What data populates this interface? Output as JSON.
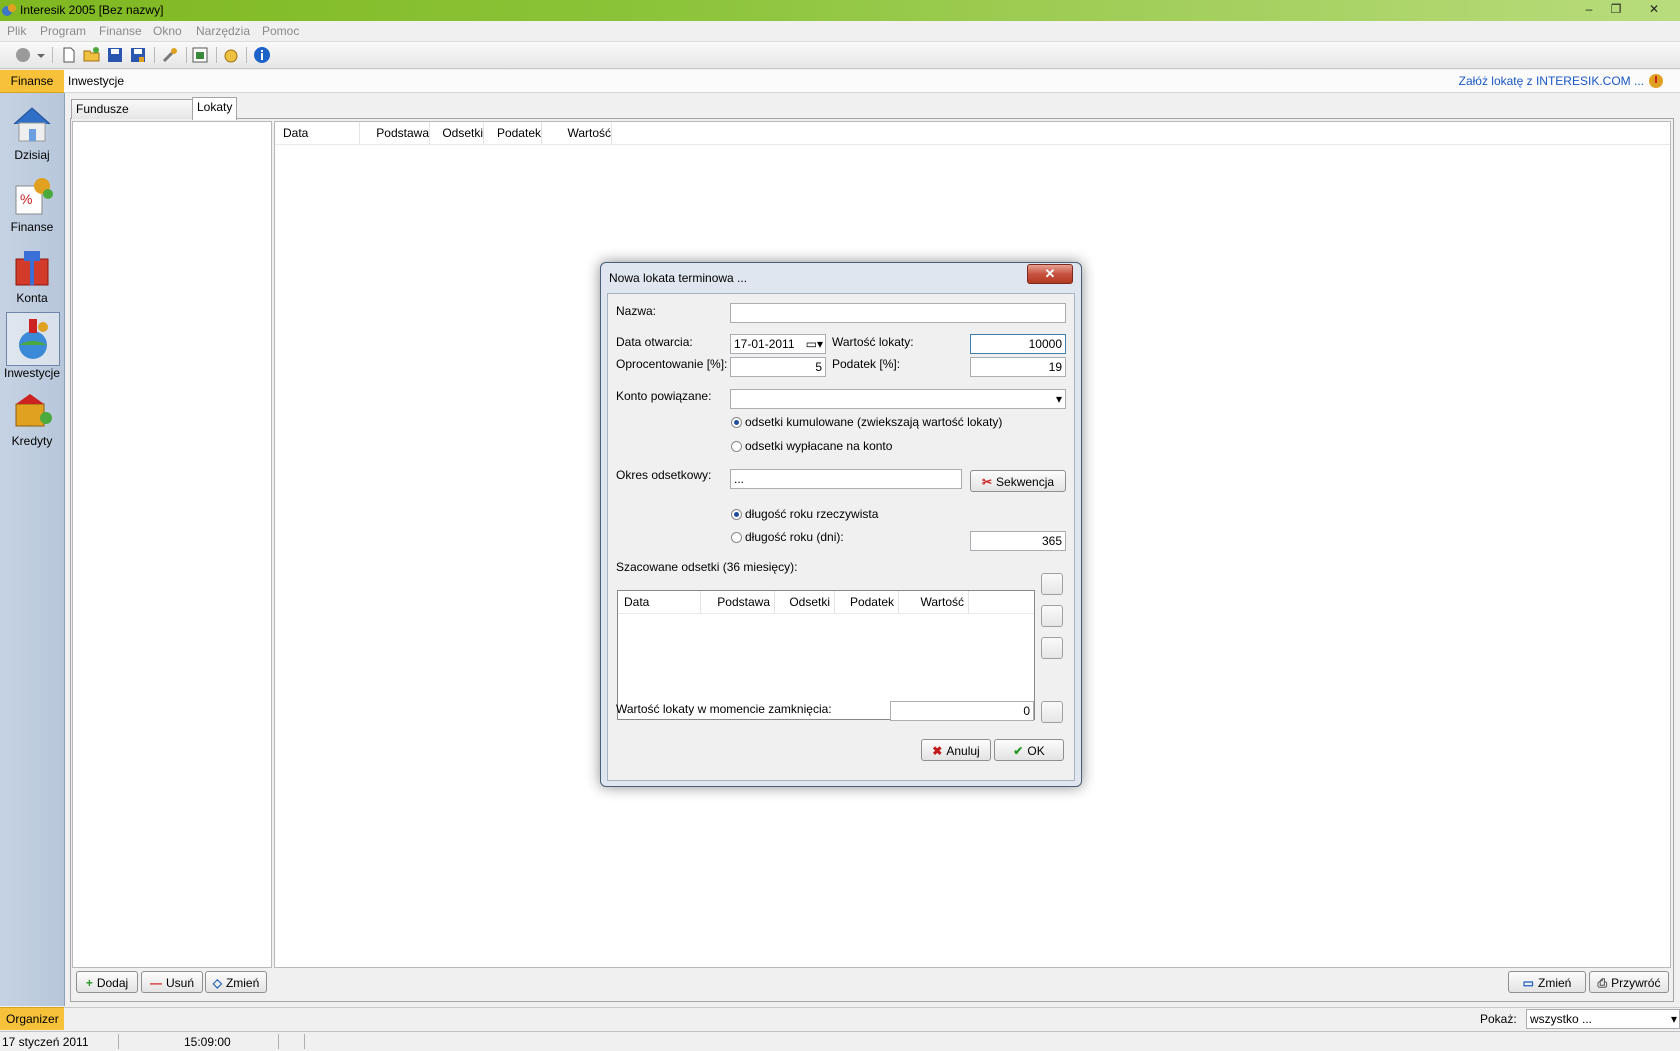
{
  "window": {
    "title": "Interesik 2005 [Bez nazwy]",
    "min": "–",
    "max": "❐",
    "close": "✕"
  },
  "menu": [
    "Plik",
    "Program",
    "Finanse",
    "Okno",
    "Narzędzia",
    "Pomoc"
  ],
  "toolbar_icons": [
    "record-icon",
    "dropdown-arrow-icon",
    "new-file-icon",
    "open-folder-icon",
    "save-icon",
    "save-as-icon",
    "tools-icon",
    "report-icon",
    "hand-icon",
    "info-icon"
  ],
  "left_nav": {
    "header": "Finanse",
    "items": [
      {
        "label": "Dzisiaj",
        "icon": "house-icon"
      },
      {
        "label": "Finanse",
        "icon": "finance-icon"
      },
      {
        "label": "Konta",
        "icon": "accounts-icon"
      },
      {
        "label": "Inwestycje",
        "icon": "investments-icon"
      },
      {
        "label": "Kredyty",
        "icon": "credits-icon"
      }
    ],
    "footer": "Organizer"
  },
  "header": {
    "section": "Inwestycje",
    "promo_link": "Załóż lokatę z INTERESIK.COM ..."
  },
  "tabs": [
    {
      "label": "Fundusze inwestycyjne"
    },
    {
      "label": "Lokaty"
    }
  ],
  "main_table": {
    "columns": [
      "Data",
      "Podstawa",
      "Odsetki",
      "Podatek",
      "Wartość"
    ]
  },
  "bottom_buttons": {
    "add": "Dodaj",
    "remove": "Usuń",
    "change": "Zmień",
    "change_right": "Zmień",
    "restore": "Przywróć"
  },
  "filter": {
    "label": "Pokaż:",
    "value": "wszystko ..."
  },
  "status": {
    "date": "17 styczeń 2011",
    "time": "15:09:00"
  },
  "dialog": {
    "title": "Nowa lokata terminowa ...",
    "name_label": "Nazwa:",
    "name_value": "",
    "open_date_label": "Data otwarcia:",
    "open_date_value": "17-01-2011",
    "deposit_value_label": "Wartość lokaty:",
    "deposit_value": "10000",
    "interest_label": "Oprocentowanie [%]:",
    "interest_value": "5",
    "tax_label": "Podatek [%]:",
    "tax_value": "19",
    "account_label": "Konto powiązane:",
    "account_value": "",
    "radio_cumulative": "odsetki kumulowane (zwiekszają wartość lokaty)",
    "radio_paid": "odsetki wypłacane na konto",
    "period_label": "Okres odsetkowy:",
    "period_value": "...",
    "sequence_button": "Sekwencja",
    "radio_real_year": "długość roku rzeczywista",
    "radio_year_days": "długość roku (dni):",
    "year_days_value": "365",
    "estimated_label": "Szacowane odsetki (36 miesięcy):",
    "estimated_columns": [
      "Data",
      "Podstawa",
      "Odsetki",
      "Podatek",
      "Wartość"
    ],
    "closing_value_label": "Wartość lokaty w momencie zamknięcia:",
    "closing_value": "0",
    "cancel": "Anuluj",
    "ok": "OK"
  },
  "colors": {
    "titlebar": "#8cc43a",
    "accent_orange": "#f7c23a",
    "link": "#1a58c4",
    "nav_bg": "#c6d3e4"
  }
}
